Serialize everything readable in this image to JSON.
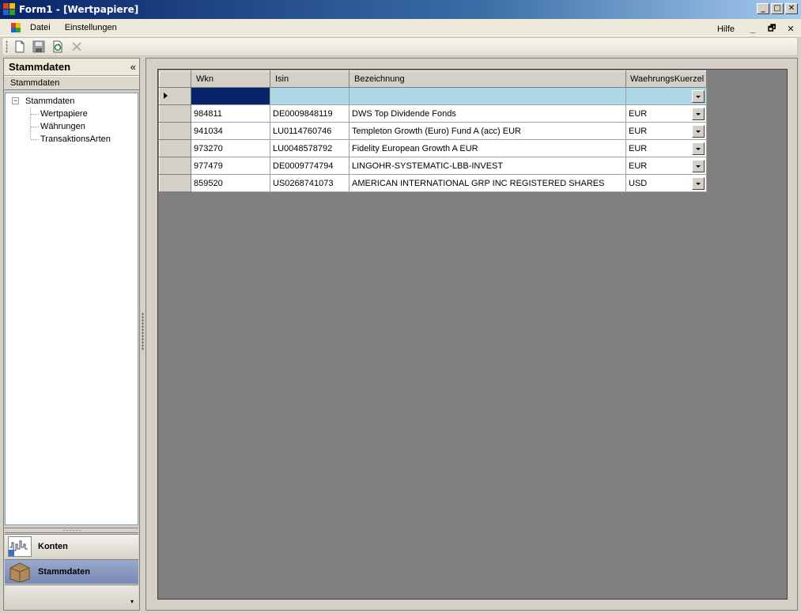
{
  "window": {
    "title": "Form1 - [Wertpapiere]",
    "controls": [
      "_",
      "□",
      "✕"
    ]
  },
  "menubar": {
    "items": [
      {
        "label": "Datei"
      },
      {
        "label": "Einstellungen"
      }
    ],
    "help": "Hilfe",
    "mdi_controls": [
      "_",
      "🗗",
      "✕"
    ]
  },
  "toolbar": {
    "icons": [
      "new-document-icon",
      "save-icon",
      "refresh-icon",
      "delete-icon"
    ]
  },
  "nav": {
    "header": "Stammdaten",
    "collapse_glyph": "«",
    "subheader": "Stammdaten",
    "tree": {
      "root": "Stammdaten",
      "expander": "−",
      "children": [
        "Wertpapiere",
        "Währungen",
        "TransaktionsArten"
      ]
    },
    "buttons": [
      {
        "label": "Konten"
      },
      {
        "label": "Stammdaten"
      }
    ],
    "footer_glyph": "▾"
  },
  "grid": {
    "columns": [
      "Wkn",
      "Isin",
      "Bezeichnung",
      "WaehrungsKuerzel"
    ],
    "rows": [
      {
        "wkn": "984811",
        "isin": "DE0009848119",
        "bezeichnung": "DWS Top Dividende Fonds",
        "waehrung": "EUR"
      },
      {
        "wkn": "941034",
        "isin": "LU0114760746",
        "bezeichnung": "Templeton Growth (Euro) Fund A (acc) EUR",
        "waehrung": "EUR"
      },
      {
        "wkn": "973270",
        "isin": "LU0048578792",
        "bezeichnung": "Fidelity European Growth A EUR",
        "waehrung": "EUR"
      },
      {
        "wkn": "977479",
        "isin": "DE0009774794",
        "bezeichnung": "LINGOHR-SYSTEMATIC-LBB-INVEST",
        "waehrung": "EUR"
      },
      {
        "wkn": "859520",
        "isin": "US0268741073",
        "bezeichnung": "AMERICAN INTERNATIONAL GRP INC REGISTERED SHARES",
        "waehrung": "USD"
      }
    ]
  },
  "colors": {
    "title_gradient_start": "#0a246a",
    "title_gradient_end": "#a6caf0",
    "new_row": "#add8e6",
    "selected_cell": "#0a246a",
    "active_nav": "#7888b4"
  }
}
